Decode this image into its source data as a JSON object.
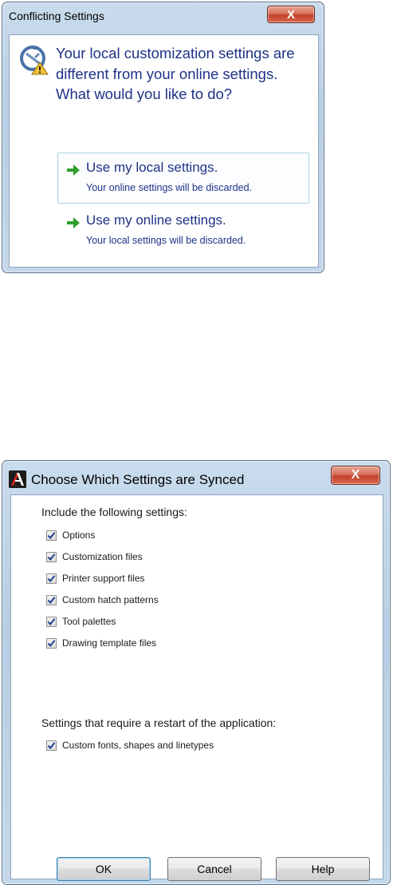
{
  "dialog1": {
    "title": "Conflicting Settings",
    "close_label": "X",
    "question": "Your local customization settings are different from your online settings. What would you like to do?",
    "options": [
      {
        "title": "Use my local settings.",
        "description": "Your online settings will be discarded.",
        "highlighted": true
      },
      {
        "title": "Use my online settings.",
        "description": "Your local settings will be discarded.",
        "highlighted": false
      }
    ]
  },
  "dialog2": {
    "title": "Choose Which Settings are Synced",
    "close_label": "X",
    "include_heading": "Include the following settings:",
    "include_items": [
      {
        "label": "Options",
        "checked": true
      },
      {
        "label": "Customization files",
        "checked": true
      },
      {
        "label": "Printer support files",
        "checked": true
      },
      {
        "label": "Custom hatch patterns",
        "checked": true
      },
      {
        "label": "Tool palettes",
        "checked": true
      },
      {
        "label": "Drawing template files",
        "checked": true
      }
    ],
    "restart_heading": "Settings that require a restart of the application:",
    "restart_items": [
      {
        "label": "Custom fonts, shapes and linetypes",
        "checked": true
      }
    ],
    "buttons": {
      "ok": "OK",
      "cancel": "Cancel",
      "help": "Help"
    }
  },
  "colors": {
    "link_blue": "#1e3287",
    "arrow_green": "#2f9e2f",
    "close_red": "#c2412a"
  }
}
